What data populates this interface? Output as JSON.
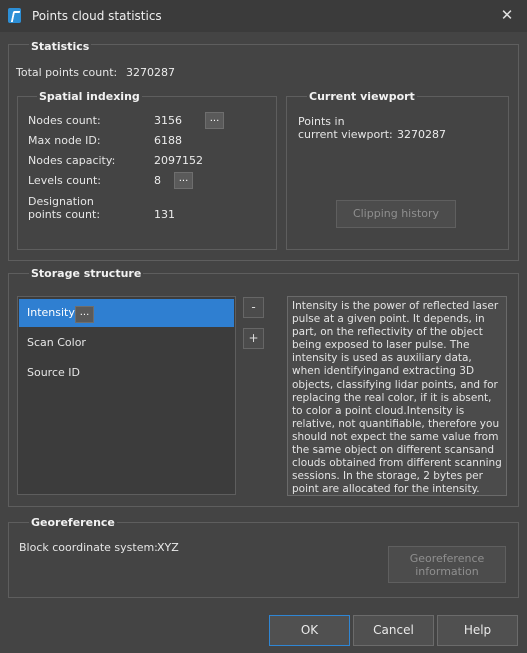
{
  "window": {
    "title": "Points cloud statistics",
    "close_glyph": "✕"
  },
  "statistics": {
    "title": "Statistics",
    "total_points_label": "Total points count:",
    "total_points_value": "3270287"
  },
  "spatial_indexing": {
    "title": "Spatial indexing",
    "nodes_count_label": "Nodes count:",
    "nodes_count_value": "3156",
    "max_node_id_label": "Max node ID:",
    "max_node_id_value": "6188",
    "nodes_capacity_label": "Nodes capacity:",
    "nodes_capacity_value": "2097152",
    "levels_count_label": "Levels count:",
    "levels_count_value": "8",
    "designation_label_line1": "Designation",
    "designation_label_line2": "points count:",
    "designation_value": "131",
    "more_button": "..."
  },
  "current_viewport": {
    "title": "Current viewport",
    "points_label_line1": "Points in",
    "points_label_line2": "current viewport:",
    "points_value": "3270287",
    "clipping_history_button": "Clipping  history"
  },
  "storage": {
    "title": "Storage structure",
    "items": [
      {
        "label": "Intensity",
        "selected": true
      },
      {
        "label": "Scan Color",
        "selected": false
      },
      {
        "label": "Source ID",
        "selected": false
      }
    ],
    "more_button": "...",
    "remove_button": "-",
    "add_button": "+",
    "description": "Intensity is the power of reflected laser pulse at a given point. It depends, in part, on the reflectivity of the object being exposed to laser pulse. The intensity is used as auxiliary data, when identifyingand extracting 3D objects, classifying lidar points, and for replacing the real color, if it is absent, to color a point cloud.Intensity is relative, not quantifiable, therefore you should not expect the same value from the same object on different scansand clouds obtained from different scanning sessions. In the storage, 2 bytes per point are allocated for the intensity."
  },
  "georeference": {
    "title": "Georeference",
    "block_cs_label": "Block coordinate system:",
    "block_cs_value": "XYZ",
    "info_button_line1": "Georeference",
    "info_button_line2": "information"
  },
  "footer": {
    "ok": "OK",
    "cancel": "Cancel",
    "help": "Help"
  },
  "colors": {
    "accent": "#2f7fd1",
    "background": "#444444"
  },
  "icons": {
    "app": "points-cloud-app-icon",
    "close": "close-icon"
  }
}
